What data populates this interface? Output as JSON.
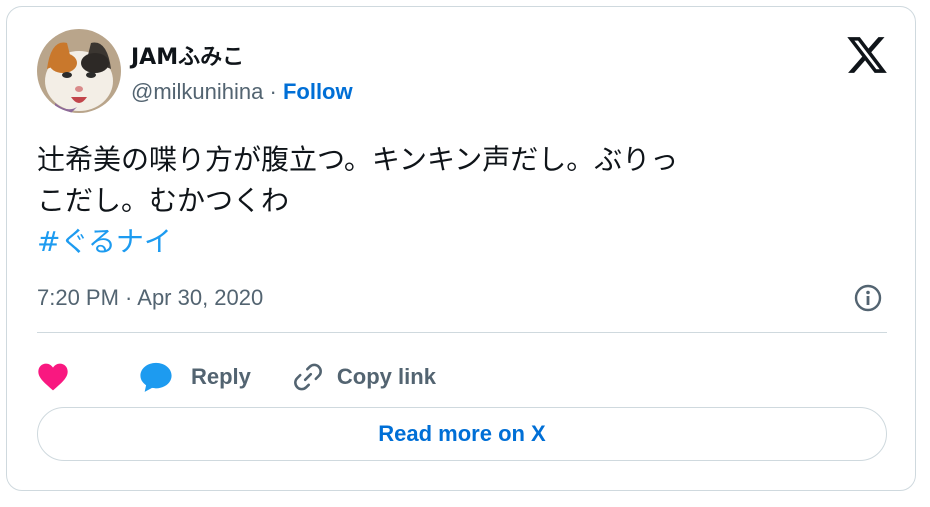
{
  "tweet": {
    "display_name": "JAMふみこ",
    "handle": "@milkunihina",
    "separator": " · ",
    "follow_label": "Follow",
    "text_line1": "辻希美の喋り方が腹立つ。キンキン声だし。ぶりっ",
    "text_line2": "こだし。むかつくわ",
    "hashtag": "#ぐるナイ",
    "timestamp": "7:20 PM · Apr 30, 2020"
  },
  "actions": {
    "like_icon": "heart-icon",
    "reply_label": "Reply",
    "copy_label": "Copy link"
  },
  "footer": {
    "read_more_label": "Read more on X"
  },
  "colors": {
    "like": "#f91880",
    "reply": "#1d9bf0",
    "link": "#006fd6",
    "muted": "#536471"
  }
}
